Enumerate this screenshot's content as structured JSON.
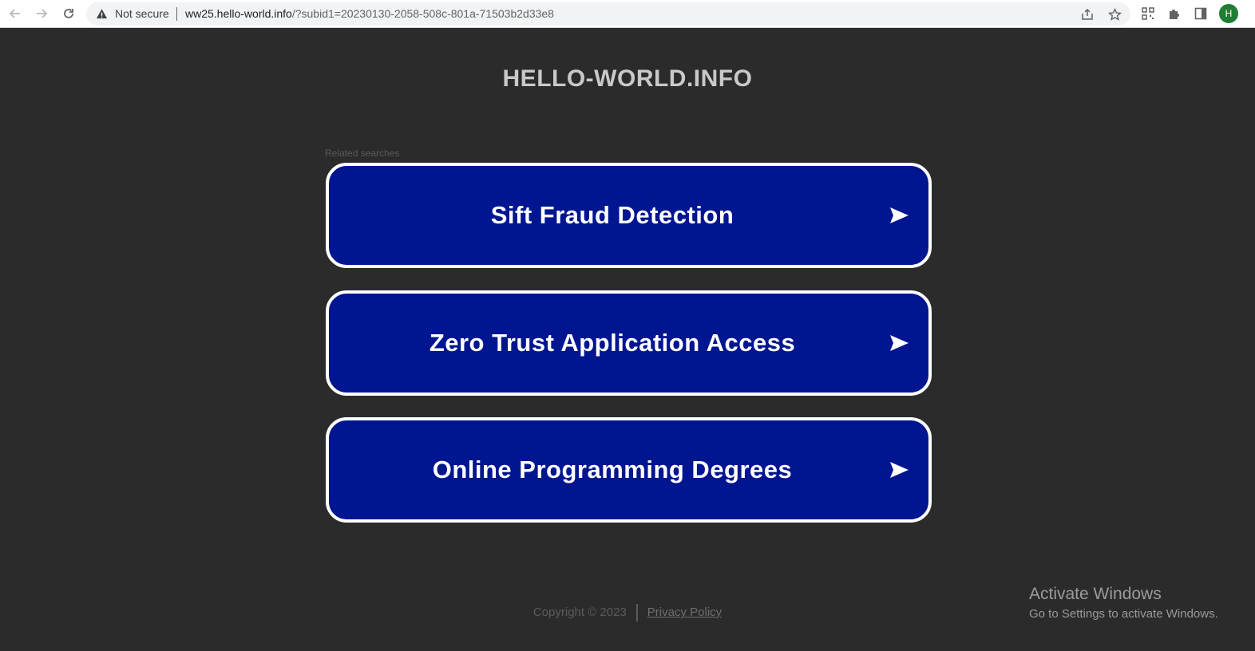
{
  "browser": {
    "security_label": "Not secure",
    "url_host": "ww25.hello-world.info",
    "url_rest": "/?subid1=20230130-2058-508c-801a-71503b2d33e8",
    "profile_initial": "H"
  },
  "page": {
    "site_title": "HELLO-WORLD.INFO",
    "related_label": "Related searches",
    "results": [
      {
        "label": "Sift Fraud Detection"
      },
      {
        "label": "Zero Trust Application Access"
      },
      {
        "label": "Online Programming Degrees"
      }
    ],
    "footer": {
      "copyright": "Copyright © 2023",
      "privacy_link": "Privacy Policy"
    }
  },
  "windows_watermark": {
    "title": "Activate Windows",
    "subtitle": "Go to Settings to activate Windows."
  },
  "colors": {
    "background": "#2b2b2b",
    "button_fill": "#001590",
    "button_border": "#ffffff"
  }
}
